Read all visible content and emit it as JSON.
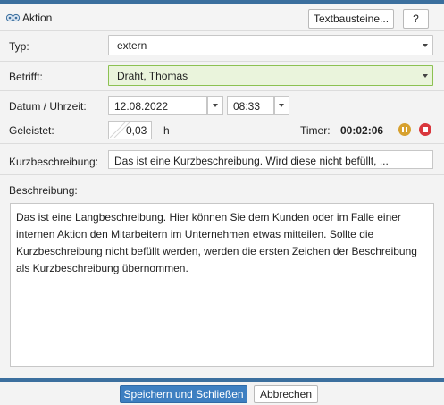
{
  "header": {
    "title": "Aktion",
    "textbausteine_label": "Textbausteine...",
    "help_label": "?"
  },
  "typ": {
    "label": "Typ:",
    "value": "extern"
  },
  "betrifft": {
    "label": "Betrifft:",
    "value": "Draht, Thomas"
  },
  "datum": {
    "label": "Datum / Uhrzeit:",
    "date": "12.08.2022",
    "time": "08:33"
  },
  "geleistet": {
    "label": "Geleistet:",
    "value": "0,03",
    "unit": "h",
    "timer_label": "Timer:",
    "timer_value": "00:02:06"
  },
  "kurzbeschreibung": {
    "label": "Kurzbeschreibung:",
    "value": "Das ist eine Kurzbeschreibung. Wird diese nicht befüllt, ..."
  },
  "beschreibung": {
    "label": "Beschreibung:",
    "value": "Das ist eine Langbeschreibung. Hier können Sie dem Kunden oder im Falle einer internen Aktion den Mitarbeitern im Unternehmen etwas mitteilen. Sollte die Kurzbeschreibung nicht befüllt werden, werden die ersten Zeichen der Beschreibung als Kurzbeschreibung übernommen."
  },
  "footer": {
    "save_label": "Speichern und Schließen",
    "cancel_label": "Abbrechen"
  },
  "colors": {
    "accent": "#3b6f9e",
    "primary_button": "#3d7fc1",
    "highlight_field": "#eaf4dc",
    "highlight_border": "#8cc152",
    "pause": "#d7a12f",
    "stop": "#d9373d"
  },
  "icons": {
    "title": "aktion-icon",
    "pause": "pause-icon",
    "stop": "stop-icon",
    "dropdown": "chevron-down-icon"
  }
}
